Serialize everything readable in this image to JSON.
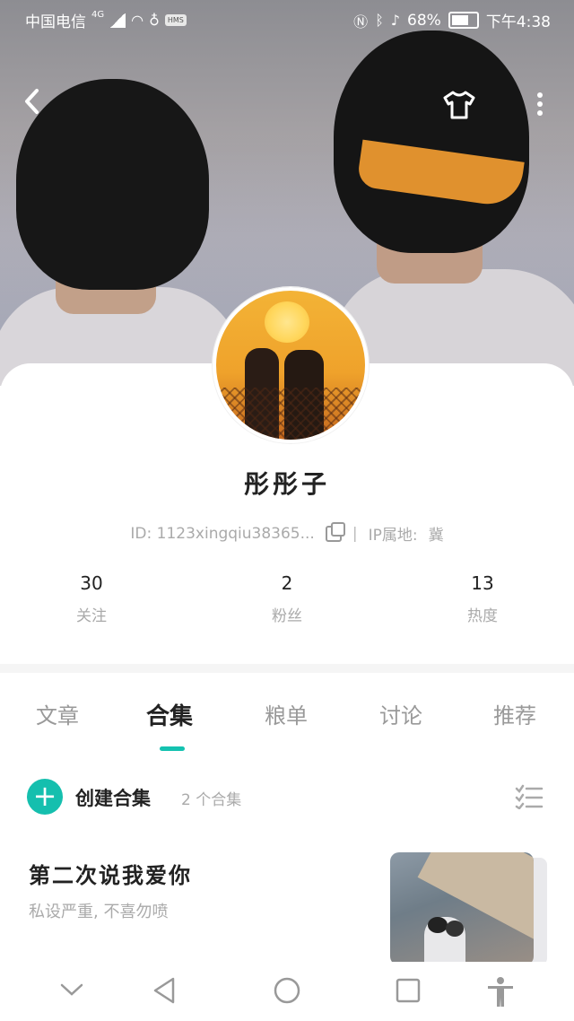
{
  "status_bar": {
    "carrier": "中国电信",
    "network": "4G",
    "hms": "HMS",
    "battery": "68%",
    "time": "下午4:38"
  },
  "profile": {
    "name": "彤彤子",
    "id": "ID: 1123xingqiu38365...",
    "separator": "|",
    "ip": "IP属地:",
    "ip_region": "冀"
  },
  "stats": [
    {
      "value": "30",
      "label": "关注"
    },
    {
      "value": "2",
      "label": "粉丝"
    },
    {
      "value": "13",
      "label": "热度"
    }
  ],
  "tabs": [
    "文章",
    "合集",
    "粮单",
    "讨论",
    "推荐"
  ],
  "active_tab": "合集",
  "collections": {
    "create_label": "创建合集",
    "count": "2 个合集"
  },
  "items": [
    {
      "title": "第二次说我爱你",
      "desc": "私设严重, 不喜勿喷"
    }
  ],
  "colors": {
    "accent": "#15bfae",
    "text_primary": "#222222",
    "text_secondary": "#aaaaaa"
  },
  "icons": {
    "back": "chevron-left-icon",
    "skin": "tshirt-icon",
    "more": "more-vertical-icon",
    "copy": "copy-icon",
    "create": "plus-icon",
    "list": "checklist-icon",
    "nav": [
      "chevron-down-icon",
      "triangle-back-icon",
      "circle-home-icon",
      "square-recents-icon",
      "accessibility-icon"
    ]
  }
}
